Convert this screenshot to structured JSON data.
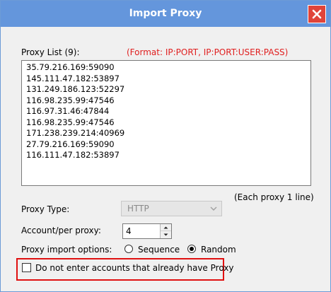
{
  "window": {
    "title": "Import Proxy"
  },
  "proxy_list": {
    "label": "Proxy List (9):",
    "format_hint": "(Format: IP:PORT, IP:PORT:USER:PASS)",
    "lines": [
      "35.79.216.169:59090",
      "145.111.47.182:53897",
      "131.249.186.123:52297",
      "116.98.235.99:47546",
      "116.97.31.46:47844",
      "116.98.235.99:47546",
      "171.238.239.214:40969",
      "27.79.216.169:59090",
      "116.111.47.182:53897"
    ],
    "line_hint": "(Each proxy 1 line)"
  },
  "proxy_type": {
    "label": "Proxy Type:",
    "value": "HTTP"
  },
  "account_per_proxy": {
    "label": "Account/per proxy:",
    "value": "4"
  },
  "import_options": {
    "label": "Proxy import options:",
    "sequence_label": "Sequence",
    "random_label": "Random",
    "selected": "Random"
  },
  "skip_existing": {
    "label": "Do not enter accounts that already have Proxy",
    "checked": false
  },
  "colors": {
    "titlebar": "#6496dc",
    "close": "#e0443a",
    "format_hint": "#e02020",
    "highlight": "#e01010"
  }
}
